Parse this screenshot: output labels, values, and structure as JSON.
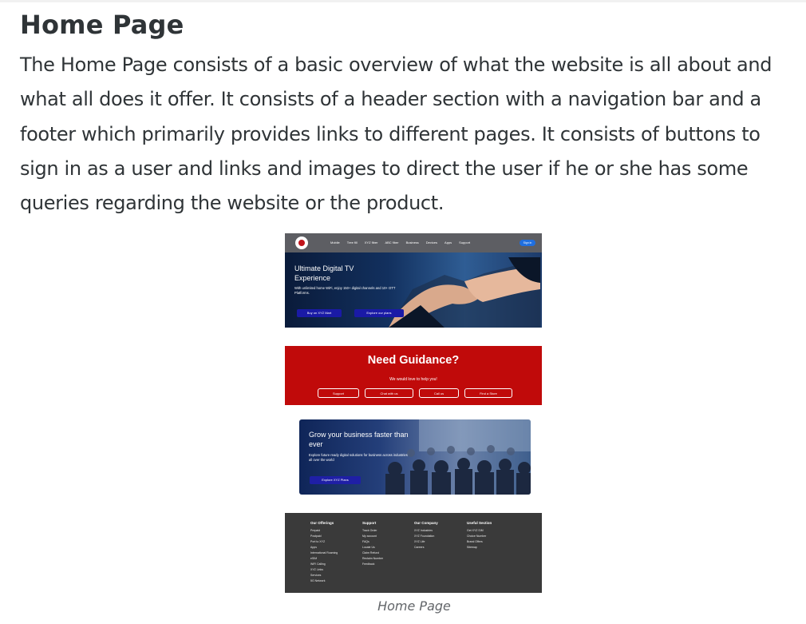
{
  "heading": "Home Page",
  "intro": "The Home Page consists of a basic overview of what the website is all about and what all does it offer. It consists of a header section with a navigation bar and a footer which primarily provides links to different pages. It consists of buttons to sign in as a user and links and images to direct the user if he or she has some queries regarding the website or the product.",
  "hero": {
    "nav": [
      "Mobile",
      "Tree fill",
      "XYZ fiber",
      "ABC fiber",
      "Business",
      "Devices",
      "Apps",
      "Support"
    ],
    "signin": "Sign in",
    "title": "Ultimate Digital TV Experience",
    "subtitle": "With unlimited home WiFi, enjoy 150+ digital channels and 10+ OTT Platforms.",
    "btn_buy": "Buy on XYZ Mart",
    "btn_plans": "Explore our plans"
  },
  "guidance": {
    "title": "Need Guidance?",
    "subtitle": "We would love to help you!",
    "buttons": [
      "Support",
      "Chat with us",
      "Call us",
      "Find a Store"
    ]
  },
  "grow": {
    "title": "Grow your business faster than ever",
    "subtitle": "Explore future ready digital solutions for business across industries all over the world",
    "button": "Explore XYZ Plans"
  },
  "footer": {
    "columns": [
      {
        "title": "Our Offerings",
        "links": [
          "Prepaid",
          "Postpaid",
          "Port to XYZ",
          "Apps",
          "International Roaming",
          "eSIM",
          "WiFi Calling",
          "XYZ Links",
          "Services",
          "5G Network"
        ]
      },
      {
        "title": "Support",
        "links": [
          "Track Order",
          "My account",
          "FAQs",
          "Locate Us",
          "Claim Refund",
          "Reclaim Number",
          "Feedback"
        ]
      },
      {
        "title": "Our Company",
        "links": [
          "XYZ Industries",
          "XYZ Foundation",
          "XYZ Life",
          "Careers"
        ]
      },
      {
        "title": "Useful Section",
        "links": [
          "Get XYZ SIM",
          "Choice Number",
          "Brand Offers",
          "Sitemap"
        ]
      }
    ]
  },
  "caption": "Home Page"
}
